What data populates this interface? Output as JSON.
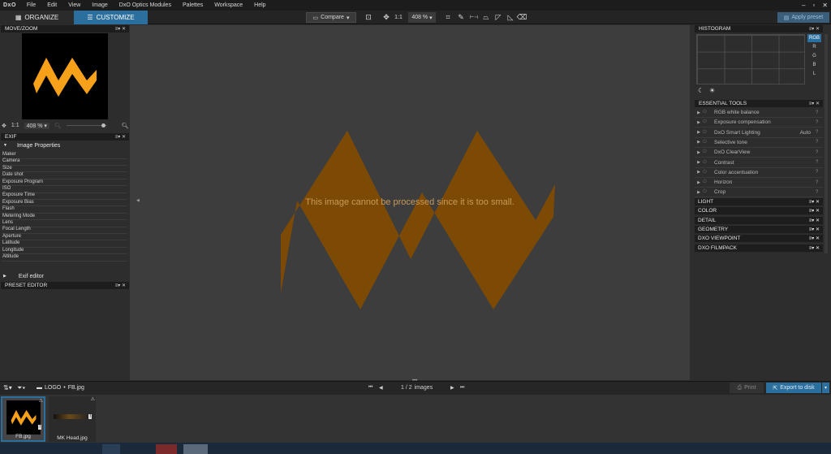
{
  "app": {
    "logo": "DxO"
  },
  "menu": [
    "File",
    "Edit",
    "View",
    "Image",
    "DxO Optics Modules",
    "Palettes",
    "Workspace",
    "Help"
  ],
  "tabs": {
    "organize": "ORGANIZE",
    "customize": "CUSTOMIZE"
  },
  "toolbar": {
    "compare": "Compare",
    "one_to_one": "1:1",
    "zoom": "408 %",
    "apply_preset": "Apply preset"
  },
  "move_zoom": {
    "title": "MOVE/ZOOM",
    "one_to_one": "1:1",
    "zoom": "408 %"
  },
  "exif": {
    "title": "EXIF",
    "section": "Image Properties",
    "rows": [
      "Maker",
      "Camera",
      "Size",
      "Date shot",
      "Exposure Program",
      "ISO",
      "Exposure Time",
      "Exposure Bias",
      "Flash",
      "Metering Mode",
      "Lens",
      "Focal Length",
      "Aperture",
      "Latitude",
      "Longitude",
      "Altitude"
    ],
    "editor": "Exif editor"
  },
  "preset_editor": {
    "title": "PRESET EDITOR"
  },
  "viewer": {
    "message": "This image cannot be processed since it is too small."
  },
  "histogram": {
    "title": "HISTOGRAM",
    "channels": [
      "RGB",
      "R",
      "G",
      "B",
      "L"
    ]
  },
  "essential_tools": {
    "title": "ESSENTIAL TOOLS",
    "items": [
      {
        "label": "RGB white balance",
        "value": ""
      },
      {
        "label": "Exposure compensation",
        "value": ""
      },
      {
        "label": "DxO Smart Lighting",
        "value": "Auto"
      },
      {
        "label": "Selective tone",
        "value": ""
      },
      {
        "label": "DxO ClearView",
        "value": ""
      },
      {
        "label": "Contrast",
        "value": ""
      },
      {
        "label": "Color accentuation",
        "value": ""
      },
      {
        "label": "Horizon",
        "value": ""
      },
      {
        "label": "Crop",
        "value": ""
      }
    ],
    "help": "?"
  },
  "palettes": [
    "LIGHT",
    "COLOR",
    "DETAIL",
    "GEOMETRY",
    "DXO VIEWPOINT",
    "DXO FILMPACK"
  ],
  "filmstrip": {
    "path_folder": "LOGO",
    "path_file": "FB.jpg",
    "counter": "1 / 2",
    "counter_unit": "images",
    "print": "Print",
    "export": "Export to disk",
    "thumbs": [
      {
        "name": "FB.jpg"
      },
      {
        "name": "MK Head.jpg"
      }
    ]
  },
  "colors": {
    "accent": "#2b6f9e",
    "logo_orange": "#f7a11a",
    "message": "#c89a5a"
  }
}
